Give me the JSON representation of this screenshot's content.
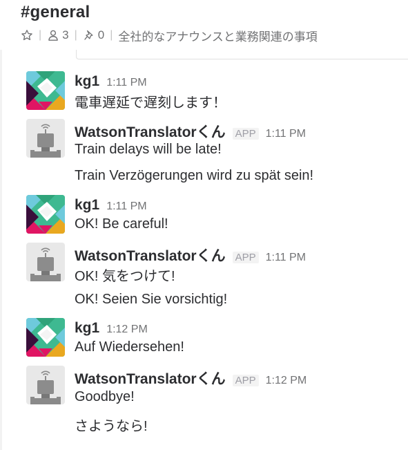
{
  "channel": {
    "name": "#general",
    "member_count": "3",
    "pinned_count": "0",
    "topic": "全社的なアナウンスと業務関連の事項"
  },
  "icons": {
    "star": "star-icon",
    "members": "person-icon",
    "pins": "pin-icon",
    "bot": "robot-avatar"
  },
  "colors": {
    "text": "#2c2d30",
    "muted": "#717274",
    "badge_bg": "#f3f3f3"
  },
  "messages": [
    {
      "sender": "kg1",
      "app": "",
      "time": "1:11 PM",
      "lines": [
        "電車遅延で遅刻します！"
      ]
    },
    {
      "sender": "WatsonTranslatorくん",
      "app": "APP",
      "time": "1:11 PM",
      "lines": [
        "Train delays will be late!",
        "Train Verzögerungen wird zu spät sein!"
      ]
    },
    {
      "sender": "kg1",
      "app": "",
      "time": "1:11 PM",
      "lines": [
        "OK! Be careful!"
      ]
    },
    {
      "sender": "WatsonTranslatorくん",
      "app": "APP",
      "time": "1:11 PM",
      "lines": [
        "OK! 気をつけて!",
        "OK! Seien Sie vorsichtig!"
      ]
    },
    {
      "sender": "kg1",
      "app": "",
      "time": "1:12 PM",
      "lines": [
        "Auf Wiedersehen!"
      ]
    },
    {
      "sender": "WatsonTranslatorくん",
      "app": "APP",
      "time": "1:12 PM",
      "lines": [
        "Goodbye!",
        "さようなら!"
      ]
    }
  ]
}
